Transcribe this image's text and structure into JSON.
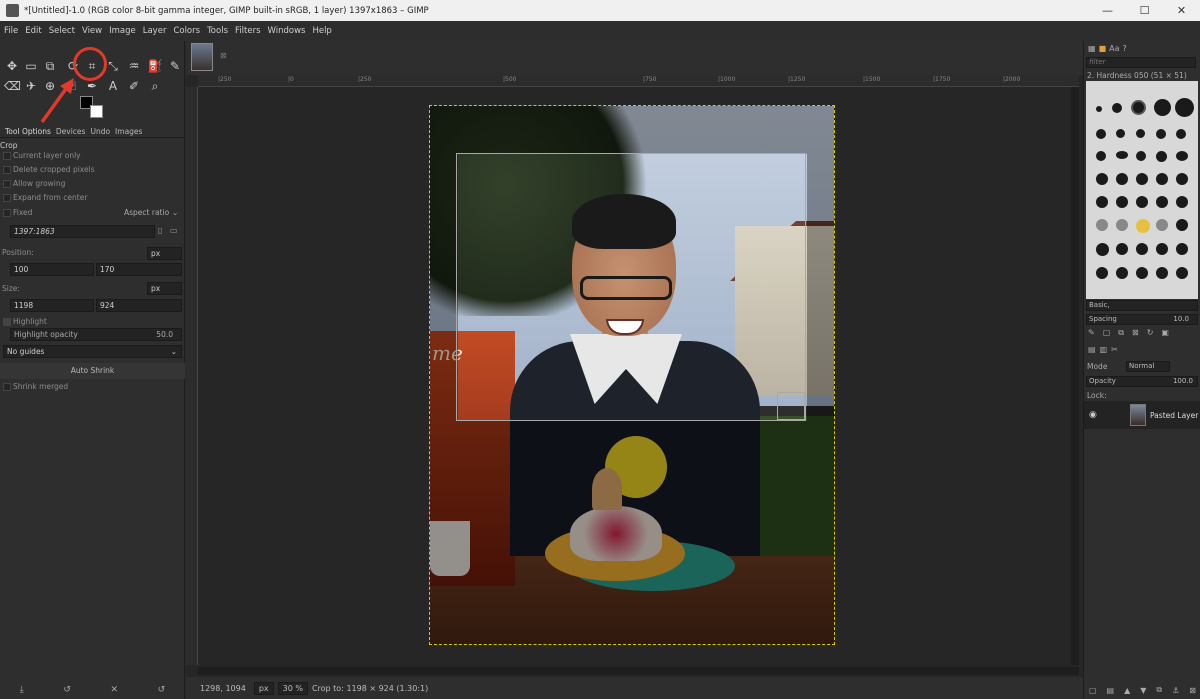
{
  "window": {
    "title": "*[Untitled]-1.0 (RGB color 8-bit gamma integer, GIMP built-in sRGB, 1 layer) 1397x1863 – GIMP",
    "minimize": "—",
    "maximize": "☐",
    "close": "✕"
  },
  "menu": [
    "File",
    "Edit",
    "Select",
    "View",
    "Image",
    "Layer",
    "Colors",
    "Tools",
    "Filters",
    "Windows",
    "Help"
  ],
  "toolbox": {
    "tabs": [
      "Tool Options",
      "Devices",
      "Undo",
      "Images"
    ],
    "tool_name": "Crop",
    "options": {
      "current_layer_only": "Current layer only",
      "delete_cropped": "Delete cropped pixels",
      "allow_growing": "Allow growing",
      "expand_from_center": "Expand from center",
      "fixed": "Fixed",
      "aspect_ratio": "Aspect ratio",
      "ratio_value": "1397:1863",
      "position_label": "Position:",
      "position_unit": "px",
      "position_x": "100",
      "position_y": "170",
      "size_label": "Size:",
      "size_unit": "px",
      "size_w": "1198",
      "size_h": "924",
      "highlight": "Highlight",
      "highlight_opacity": "Highlight opacity",
      "highlight_opacity_value": "50.0",
      "guides": "No guides",
      "auto_shrink": "Auto Shrink",
      "shrink_merged": "Shrink merged"
    }
  },
  "canvas": {
    "ruler_labels": [
      "|250",
      "|0",
      "|250",
      "|500",
      "|750",
      "|1000",
      "|1250",
      "|1500",
      "|1750",
      "|2000"
    ],
    "sign_text": "me",
    "status": {
      "coords": "1298, 1094",
      "unit": "px",
      "zoom": "30 %",
      "message": "Crop to: 1198 × 924  (1.30:1)"
    }
  },
  "rightdock": {
    "filter_placeholder": "filter",
    "brush_name": "2. Hardness 050 (51 × 51)",
    "brush_tag": "Basic,",
    "spacing_label": "Spacing",
    "spacing_value": "10.0",
    "mode_label": "Mode",
    "mode_value": "Normal",
    "opacity_label": "Opacity",
    "opacity_value": "100.0",
    "lock_label": "Lock:",
    "layer_name": "Pasted Layer"
  }
}
